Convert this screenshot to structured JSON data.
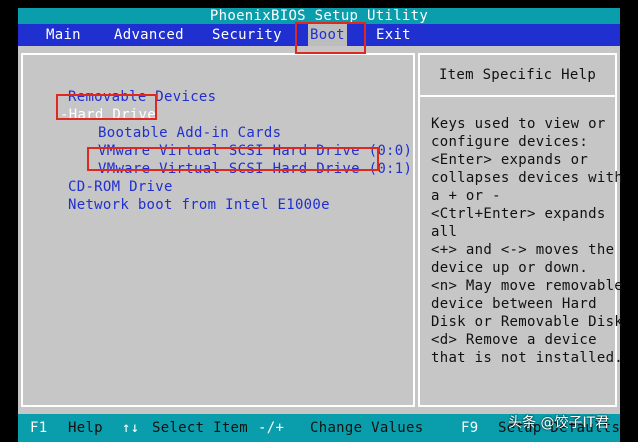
{
  "title": "PhoenixBIOS Setup Utility",
  "menu": {
    "main": "Main",
    "advanced": "Advanced",
    "security": "Security",
    "boot": "Boot",
    "exit": "Exit",
    "active": "Boot"
  },
  "boot_list": {
    "removable": "Removable Devices",
    "hard_drive": "-Hard Drive",
    "bootable_addin": "Bootable Add-in Cards",
    "vmware_0_0": "VMware Virtual SCSI Hard Drive (0:0)",
    "vmware_0_1": "VMware Virtual SCSI Hard Drive (0:1)",
    "cdrom": "CD-ROM Drive",
    "network": "Network boot from Intel E1000e"
  },
  "help": {
    "title": "Item Specific Help",
    "lines": [
      "Keys used to view or",
      "configure devices:",
      "<Enter> expands or",
      "collapses devices with",
      "a + or -",
      "<Ctrl+Enter> expands",
      "all",
      "<+> and <-> moves the",
      "device up or down.",
      "<n> May move removable",
      "device between Hard",
      "Disk or Removable Disk",
      "<d> Remove a device",
      "that is not installed."
    ]
  },
  "status": {
    "f1_key": "F1",
    "f1_label": "Help",
    "updown_key": "↑↓",
    "updown_label": "Select Item",
    "plusminus_key": "-/+",
    "plusminus_label": "Change Values",
    "f9_key": "F9",
    "f9_label": "Setup Defaults"
  },
  "watermark": "头条 @饺子IT君",
  "colors": {
    "menu_bg": "#1f2fd0",
    "title_bg": "#0a9dab",
    "panel_bg": "#c6c6c6",
    "item_text": "#1f2fd0",
    "highlight_box": "#e0281f"
  }
}
